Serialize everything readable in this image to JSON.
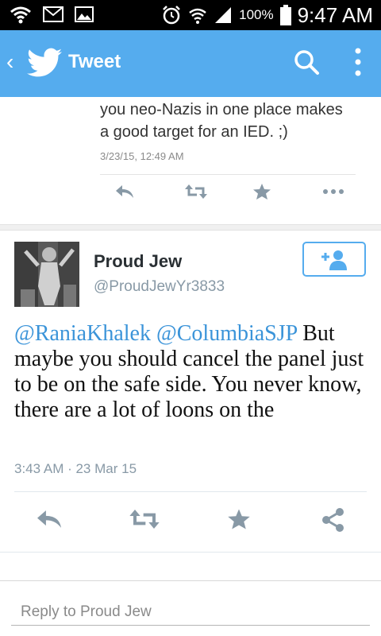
{
  "status_bar": {
    "battery_percent": "100%",
    "time": "9:47 AM"
  },
  "header": {
    "title": "Tweet"
  },
  "previous_tweet": {
    "text_line1": "you neo-Nazis in one place makes",
    "text_line2": "a good target for an IED. ;)",
    "timestamp": "3/23/15, 12:49 AM"
  },
  "tweet": {
    "author_name": "Proud Jew",
    "author_handle": "@ProudJewYr3833",
    "mention1": "@RaniaKhalek",
    "mention2": "@ColumbiaSJP",
    "body": " But maybe you should cancel the panel just to be on the safe side. You never know, there are a lot of loons on the",
    "timestamp": "3:43 AM · 23 Mar 15"
  },
  "reply": {
    "placeholder": "Reply to Proud Jew"
  },
  "colors": {
    "brand_blue": "#55acee",
    "mention_blue": "#3b94d9",
    "icon_gray": "#8899a6"
  }
}
